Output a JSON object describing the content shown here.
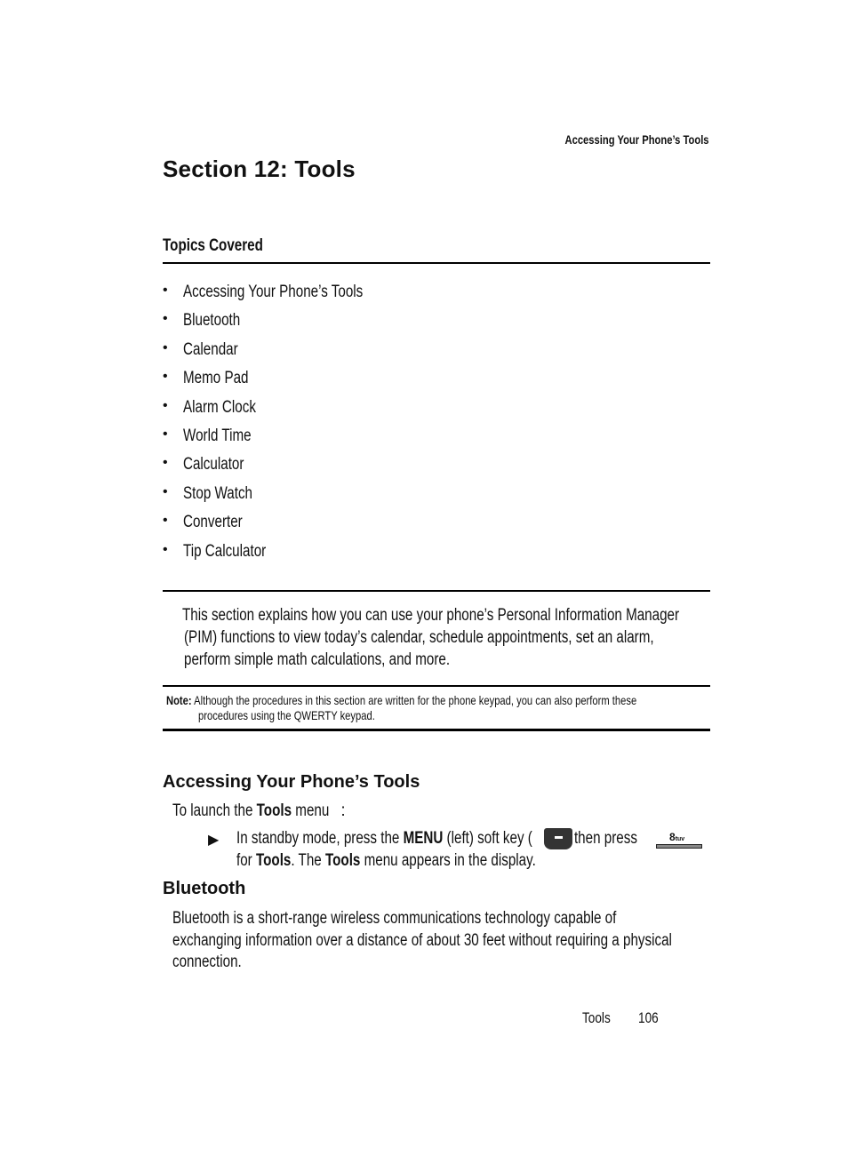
{
  "running_head": "Accessing Your Phone’s Tools",
  "section_title": "Section 12: Tools",
  "topics": {
    "heading": "Topics Covered",
    "items": [
      "Accessing Your Phone’s Tools",
      "Bluetooth",
      "Calendar",
      "Memo Pad",
      "Alarm Clock",
      "World Time",
      "Calculator",
      "Stop Watch",
      "Converter",
      "Tip Calculator"
    ],
    "bullet": "•"
  },
  "intro_lines": [
    "This section explains how you can use your phone’s Personal Information Manager",
    "(PIM) functions to view today’s calendar, schedule appointments, set an alarm,",
    "perform simple math calculations, and more."
  ],
  "note": {
    "label": "Note:",
    "line1": "Although the procedures in this section are written for the phone keypad, you can also perform these",
    "line2": "procedures using the QWERTY keypad."
  },
  "accessing": {
    "heading": "Accessing Your Phone’s Tools",
    "procedure_prefix": "To launch the ",
    "procedure_bold": "Tools",
    "procedure_suffix": " menu",
    "procedure_colon": ":",
    "step_arrow": "▶",
    "step": {
      "t1": "In standby mode, press the ",
      "b1": "MENU",
      "t2": " (left) soft key (",
      "t3": "), then press",
      "t4": "for ",
      "b2": "Tools",
      "t5": ". The ",
      "b3": "Tools",
      "t6": " menu appears in the display."
    },
    "menu_key_icon": "left-soft-key-icon",
    "key8": {
      "digit": "8",
      "letters": "tuv"
    }
  },
  "bluetooth": {
    "heading": "Bluetooth",
    "lines": [
      "Bluetooth is a short-range wireless communications technology capable of",
      "exchanging information over a distance of about 30 feet without requiring a physical",
      "connection."
    ]
  },
  "footer": {
    "section": "Tools",
    "page": "106"
  }
}
